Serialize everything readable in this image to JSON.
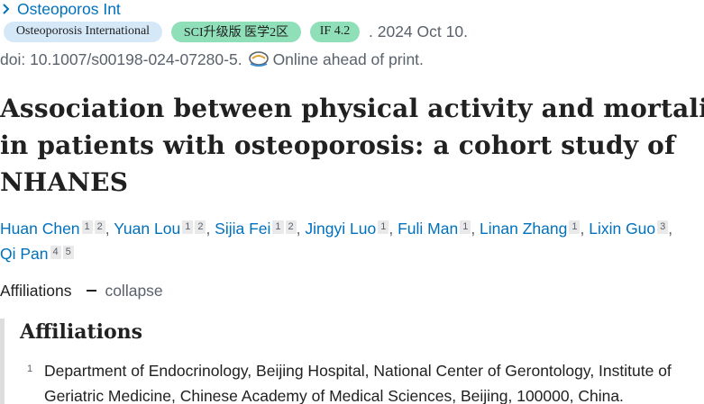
{
  "journal": {
    "name": "Osteoporos Int"
  },
  "badges": {
    "journal_full": "Osteoporosis International",
    "sci": "SCI升级版 医学2区",
    "impact": "IF 4.2"
  },
  "pubdate": ". 2024 Oct 10.",
  "doi": "doi: 10.1007/s00198-024-07280-5.",
  "online_status": "Online ahead of print.",
  "title_lines": [
    "Association between physical activity and mortality",
    "in patients with osteoporosis: a cohort study of",
    "NHANES"
  ],
  "authors": [
    {
      "name": "Huan Chen",
      "affs": [
        "1",
        "2"
      ]
    },
    {
      "name": "Yuan Lou",
      "affs": [
        "1",
        "2"
      ]
    },
    {
      "name": "Sijia Fei",
      "affs": [
        "1",
        "2"
      ]
    },
    {
      "name": "Jingyi Luo",
      "affs": [
        "1"
      ]
    },
    {
      "name": "Fuli Man",
      "affs": [
        "1"
      ]
    },
    {
      "name": "Linan Zhang",
      "affs": [
        "1"
      ]
    },
    {
      "name": "Lixin Guo",
      "affs": [
        "3"
      ]
    },
    {
      "name": "Qi Pan",
      "affs": [
        "4",
        "5"
      ]
    }
  ],
  "affiliations_toggle": {
    "label": "Affiliations",
    "action": "collapse"
  },
  "affiliations_panel": {
    "heading": "Affiliations",
    "items": [
      {
        "num": "1",
        "text": "Department of Endocrinology, Beijing Hospital, National Center of Gerontology, Institute of Geriatric Medicine, Chinese Academy of Medical Sciences, Beijing, 100000, China."
      }
    ]
  }
}
